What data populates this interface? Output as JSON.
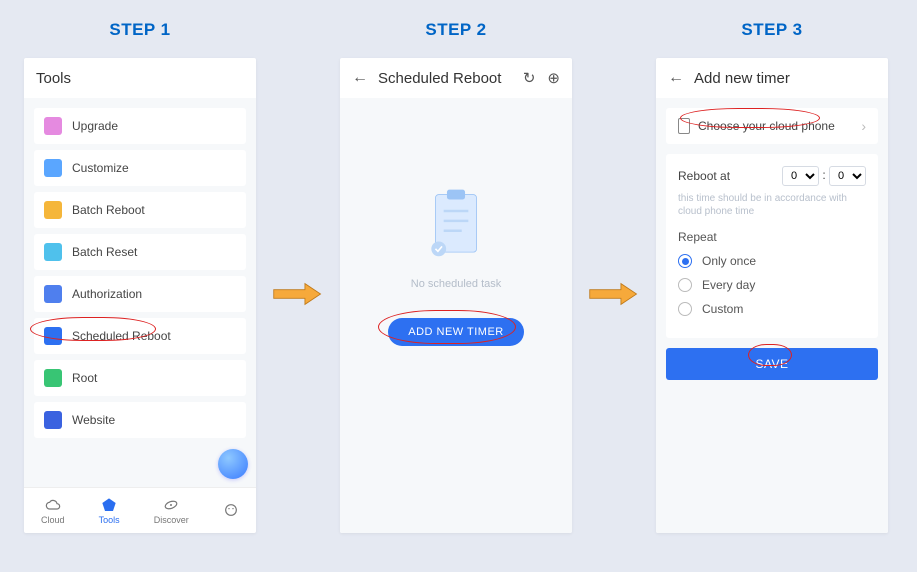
{
  "steps": {
    "s1": "STEP 1",
    "s2": "STEP 2",
    "s3": "STEP 3"
  },
  "screen1": {
    "title": "Tools",
    "items": [
      {
        "label": "Upgrade",
        "icon_color": "#e58ae0"
      },
      {
        "label": "Customize",
        "icon_color": "#5aa6ff"
      },
      {
        "label": "Batch Reboot",
        "icon_color": "#f5b63a"
      },
      {
        "label": "Batch Reset",
        "icon_color": "#4fc1ec"
      },
      {
        "label": "Authorization",
        "icon_color": "#4f7fee"
      },
      {
        "label": "Scheduled Reboot",
        "icon_color": "#2d70f1"
      },
      {
        "label": "Root",
        "icon_color": "#38c574"
      },
      {
        "label": "Website",
        "icon_color": "#3a62e0"
      }
    ],
    "nav": {
      "cloud": "Cloud",
      "tools": "Tools",
      "discover": "Discover",
      "more": ""
    }
  },
  "screen2": {
    "title": "Scheduled Reboot",
    "empty_text": "No scheduled task",
    "add_button": "ADD NEW TIMER"
  },
  "screen3": {
    "title": "Add new timer",
    "choose_label": "Choose your cloud phone",
    "reboot_label": "Reboot at",
    "hour_value": "0",
    "minute_value": "0",
    "time_sep": ":",
    "hint": "this time should be in accordance with cloud phone time",
    "repeat_label": "Repeat",
    "options": {
      "once": "Only once",
      "daily": "Every day",
      "custom": "Custom"
    },
    "save": "SAVE"
  }
}
